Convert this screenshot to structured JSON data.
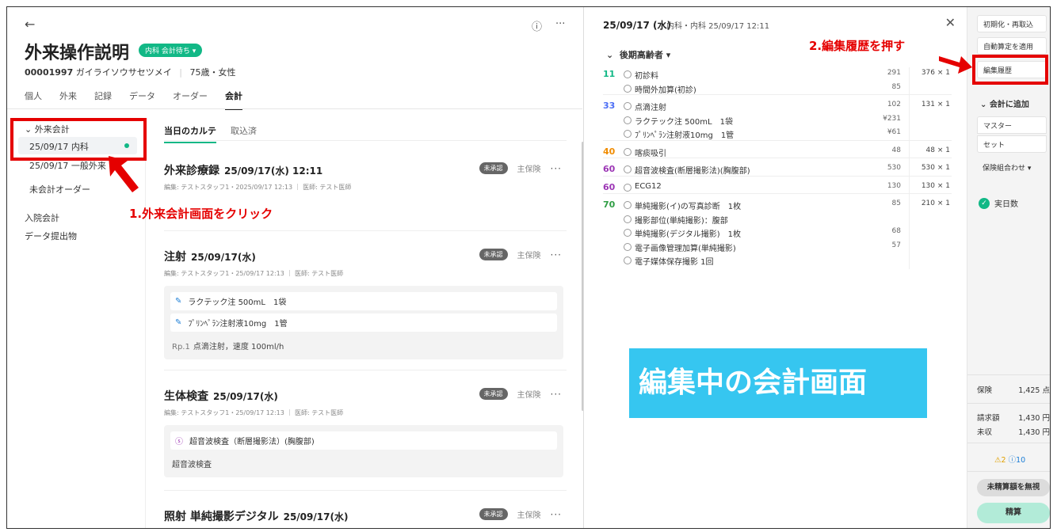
{
  "header": {
    "title": "外来操作説明",
    "status_badge": "内科 会計待ち",
    "patient_id": "00001997",
    "patient_kana": "ガイライソウサセツメイ",
    "patient_info": "75歳・女性",
    "tabs": [
      "個人",
      "外来",
      "記録",
      "データ",
      "オーダー",
      "会計"
    ],
    "active_tab": "会計"
  },
  "sidebar": {
    "group_label": "外来会計",
    "items": [
      {
        "label": "25/09/17 内科"
      },
      {
        "label": "25/09/17 一般外来"
      },
      {
        "label": "未会計オーダー"
      }
    ],
    "links": [
      "入院会計",
      "データ提出物"
    ]
  },
  "subtabs": [
    "当日のカルテ",
    "取込済"
  ],
  "cards": [
    {
      "title": "外来診療録",
      "date": "25/09/17(水) 12:11",
      "meta": "編集: テストスタッフ1・2025/09/17 12:13 ｜ 医師: テスト医師",
      "badge": "未承認",
      "insurance": "主保険"
    },
    {
      "title": "注射",
      "date": "25/09/17(水)",
      "meta": "編集: テストスタッフ1・25/09/17 12:13 ｜ 医師: テスト医師",
      "badge": "未承認",
      "insurance": "主保険",
      "rows": [
        "ラクテック注 500mL　1袋",
        "ﾌﾟﾘﾝﾍﾟﾗﾝ注射液10mg　1管"
      ],
      "note_rp": "Rp.1",
      "note": "点滴注射，速度 100ml/h"
    },
    {
      "title": "生体検査",
      "date": "25/09/17(水)",
      "meta": "編集: テストスタッフ1・25/09/17 12:13 ｜ 医師: テスト医師",
      "badge": "未承認",
      "insurance": "主保険",
      "rows": [
        "超音波検査（断層撮影法）(胸腹部)"
      ],
      "note": "超音波検査"
    },
    {
      "title": "照射 単純撮影デジタル",
      "date": "25/09/17(水)",
      "badge": "未承認",
      "insurance": "主保険"
    }
  ],
  "annotations": {
    "step1": "1.外来会計画面をクリック",
    "step2": "2.編集履歴を押す",
    "overlay": "編集中の会計画面"
  },
  "mid": {
    "date": "25/09/17 (水)",
    "sub": "内科・内科 25/09/17 12:11",
    "group": "後期高齢者",
    "entries": [
      {
        "code": "11",
        "color": "#12b886",
        "name": "初診料",
        "pts": "291",
        "total": "376 × 1"
      },
      {
        "code": "",
        "color": "",
        "name": "時間外加算(初診)",
        "pts": "85",
        "total": ""
      },
      {
        "code": "33",
        "color": "#4c6ef5",
        "name": "点滴注射",
        "pts": "102",
        "total": "131 × 1"
      },
      {
        "code": "",
        "color": "",
        "name": "ラクテック注 500mL　1袋",
        "pts": "¥231",
        "total": ""
      },
      {
        "code": "",
        "color": "",
        "name": "ﾌﾟﾘﾝﾍﾟﾗﾝ注射液10mg　1管",
        "pts": "¥61",
        "total": ""
      },
      {
        "code": "40",
        "color": "#f08c00",
        "name": "喀痰吸引",
        "pts": "48",
        "total": "48 × 1"
      },
      {
        "code": "60",
        "color": "#9c36b5",
        "name": "超音波検査(断層撮影法)(胸腹部)",
        "pts": "530",
        "total": "530 × 1"
      },
      {
        "code": "60",
        "color": "#9c36b5",
        "name": "ECG12",
        "pts": "130",
        "total": "130 × 1"
      },
      {
        "code": "70",
        "color": "#2f9e44",
        "name": "単純撮影(イ)の写真診断　1枚",
        "pts": "85",
        "total": "210 × 1"
      },
      {
        "code": "",
        "color": "",
        "name": "撮影部位(単純撮影)：腹部",
        "pts": "",
        "total": ""
      },
      {
        "code": "",
        "color": "",
        "name": "単純撮影(デジタル撮影)　1枚",
        "pts": "68",
        "total": ""
      },
      {
        "code": "",
        "color": "",
        "name": "電子画像管理加算(単純撮影)",
        "pts": "57",
        "total": ""
      },
      {
        "code": "",
        "color": "",
        "name": "電子媒体保存撮影 1回",
        "pts": "",
        "total": ""
      }
    ]
  },
  "right": {
    "buttons": [
      "初期化・再取込",
      "自動算定を適用",
      "編集履歴"
    ],
    "add_label": "会計に追加",
    "add_items": [
      "マスター",
      "セット"
    ],
    "insurance_select": "保険組合わせ",
    "days_label": "実日数",
    "summary": {
      "hoken_label": "保険",
      "hoken_value": "1,425 点",
      "seikyu_label": "請求額",
      "seikyu_value": "1,430 円",
      "mishu_label": "未収",
      "mishu_value": "1,430 円"
    },
    "warn_count": "2",
    "info_count": "10",
    "ignore_button": "未精算額を無視",
    "settle_button": "精算"
  },
  "colors": {
    "accent": "#12b886",
    "annotation": "#e50000",
    "overlay": "#36c6f0"
  }
}
